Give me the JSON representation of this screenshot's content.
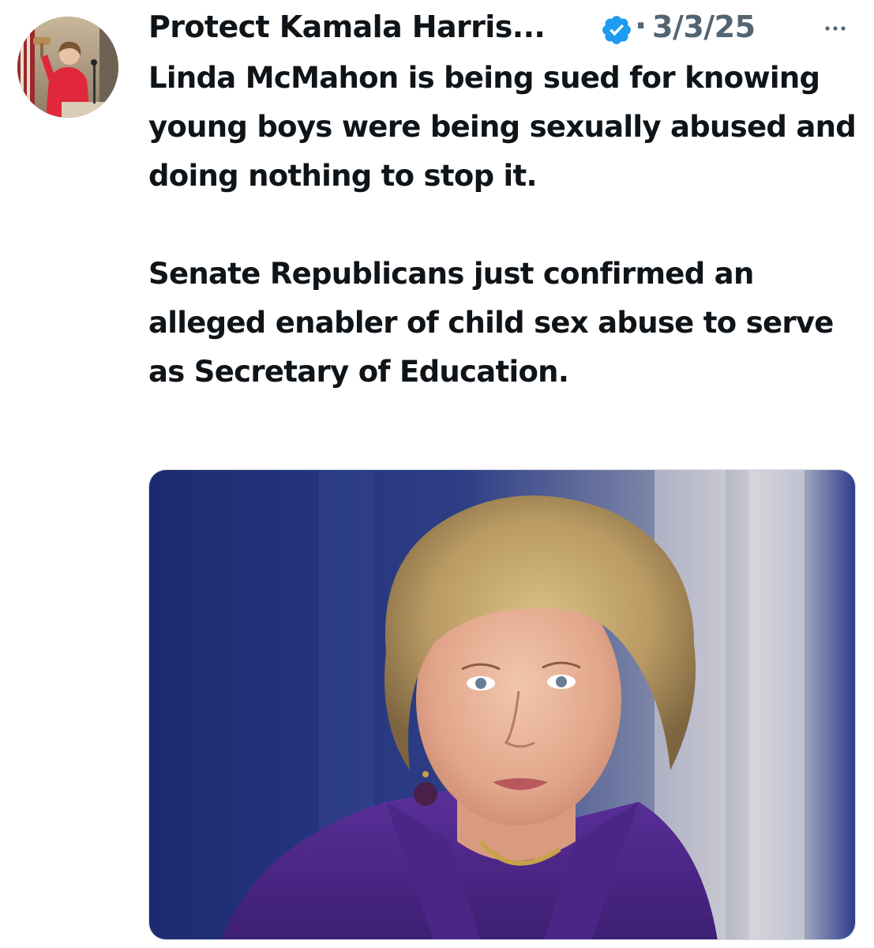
{
  "tweet": {
    "author": {
      "display_name": "Protect Kamala Harris...",
      "verified": true,
      "avatar_icon": "profile-photo"
    },
    "separator": "·",
    "timestamp": "3/3/25",
    "more_icon": "more-options-icon",
    "text": {
      "paragraph_1": "Linda McMahon is being sued for knowing young boys were being sexually abused and doing nothing to stop it.",
      "paragraph_2": "Senate Republicans just confirmed an alleged enabler of child sex abuse to serve as Secretary of Education."
    },
    "media": {
      "type": "photo"
    }
  },
  "colors": {
    "text_primary": "#0f1419",
    "text_secondary": "#536471",
    "verified_blue": "#1d9bf0",
    "background": "#ffffff"
  }
}
